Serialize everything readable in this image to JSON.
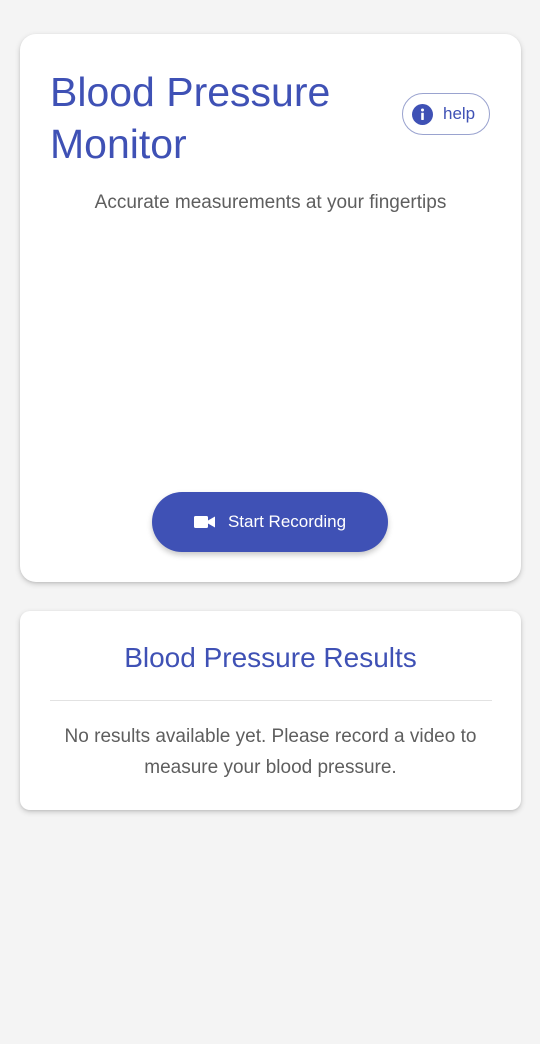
{
  "header": {
    "title": "Blood Pressure Monitor",
    "subtitle": "Accurate measurements at your fingertips",
    "help_label": "help",
    "help_icon": "info-icon"
  },
  "recorder": {
    "button_label": "Start Recording",
    "button_icon": "videocam-icon"
  },
  "results": {
    "title": "Blood Pressure Results",
    "empty_message": "No results available yet. Please record a video to measure your blood pressure."
  },
  "colors": {
    "primary": "#3f51b5",
    "background": "#f4f4f4",
    "card": "#ffffff",
    "text_secondary": "#5e5e5e"
  }
}
